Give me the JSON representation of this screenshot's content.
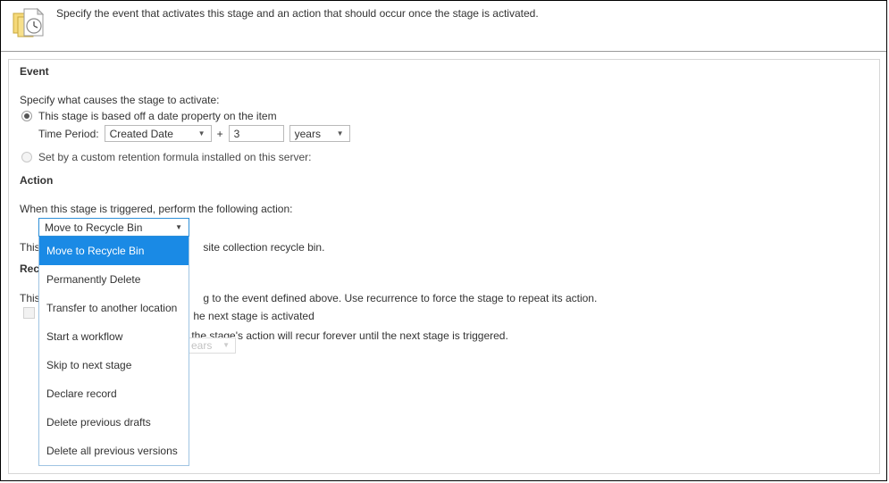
{
  "header": {
    "icon": "documents-clock-icon",
    "description": "Specify the event that activates this stage and an action that should occur once the stage is activated."
  },
  "event_section": {
    "title": "Event",
    "prompt": "Specify what causes the stage to activate:",
    "option_date_property": "This stage is based off a date property on the item",
    "option_custom_formula": "Set by a custom retention formula installed on this server:",
    "time_period_label": "Time Period:",
    "date_property_value": "Created Date",
    "plus_sign": "+",
    "amount_value": "3",
    "unit_value": "years"
  },
  "action_section": {
    "title": "Action",
    "prompt": "When this stage is triggered, perform the following action:",
    "selected_action": "Move to Recycle Bin",
    "description_suffix": "site collection recycle bin.",
    "description_prefix": "This",
    "options": [
      "Move to Recycle Bin",
      "Permanently Delete",
      "Transfer to another location",
      "Start a workflow",
      "Skip to next stage",
      "Declare record",
      "Delete previous drafts",
      "Delete all previous versions"
    ]
  },
  "recurrence_section": {
    "title": "Recurrence",
    "description_prefix": "This",
    "description_suffix": "g to the event defined above. Use recurrence to force the stage to repeat its action.",
    "option_until_next_stage": "he next stage is activated",
    "option_recur_forever": "the stage's action will recur forever until the next stage is triggered.",
    "unit_value": "ears"
  },
  "colors": {
    "highlight": "#1a8ae5",
    "focus_border": "#2d8fd8",
    "panel_border": "#d6d6d6",
    "window_border": "#000000"
  }
}
